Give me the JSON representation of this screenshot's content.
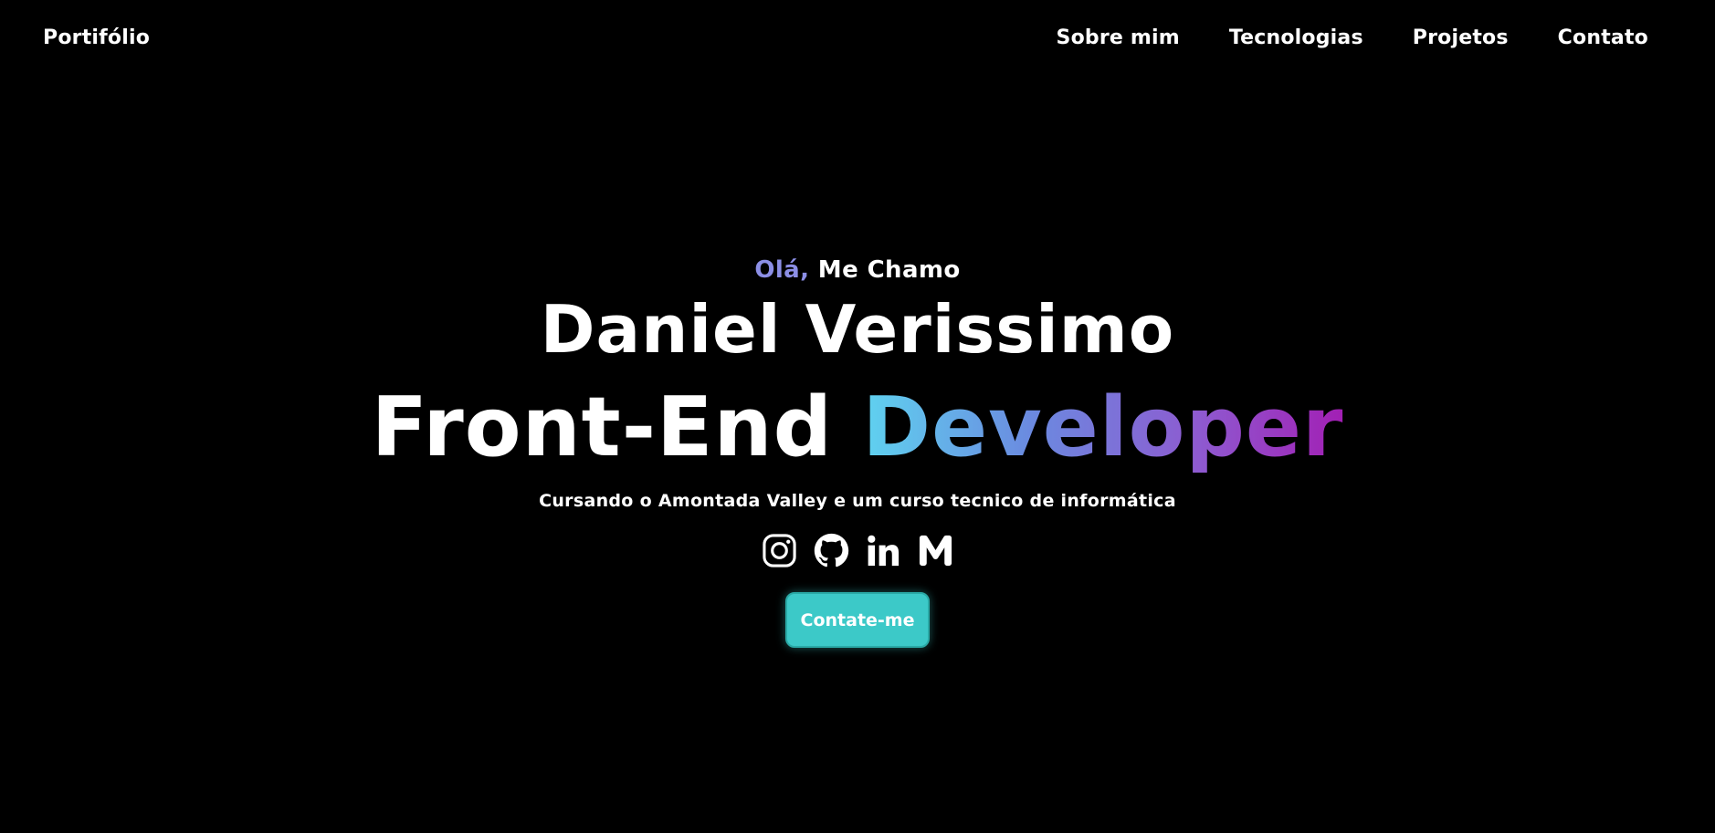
{
  "nav": {
    "brand": "Portifólio",
    "links": [
      {
        "label": "Sobre mim"
      },
      {
        "label": "Tecnologias"
      },
      {
        "label": "Projetos"
      },
      {
        "label": "Contato"
      }
    ]
  },
  "hero": {
    "greeting_hi": "Olá,",
    "greeting_rest": " Me Chamo",
    "name": "Daniel Verissimo",
    "role_main": "Front-End ",
    "role_accent": "Developer",
    "subtitle": "Cursando o Amontada Valley e um curso tecnico de informática",
    "cta_label": "Contate-me",
    "socials": [
      {
        "icon": "instagram-icon"
      },
      {
        "icon": "github-icon"
      },
      {
        "icon": "linkedin-icon"
      },
      {
        "icon": "medium-icon"
      }
    ]
  },
  "colors": {
    "background": "#000000",
    "text": "#ffffff",
    "greeting_accent": "#8c8fe6",
    "gradient_start": "#5fd3f0",
    "gradient_end": "#a21fb4",
    "button": "#3cc9c8"
  }
}
